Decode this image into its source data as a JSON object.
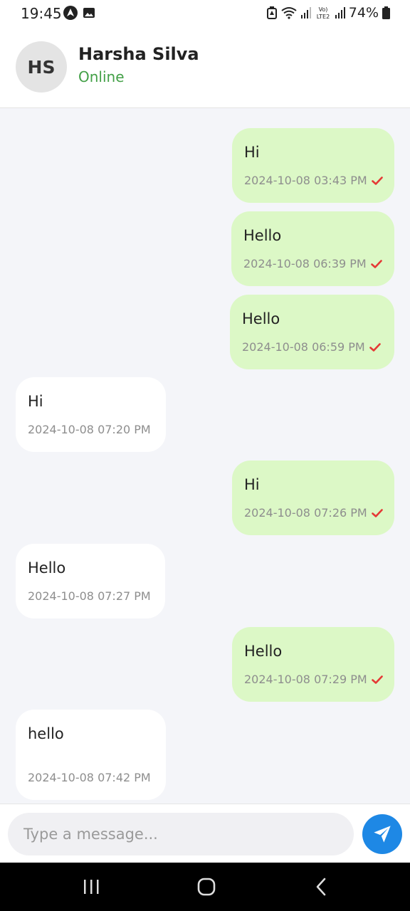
{
  "status_bar": {
    "time": "19:45",
    "battery": "74%",
    "icons": [
      "navigation-app-icon",
      "image-notification-icon",
      "battery-saver-icon",
      "wifi-icon",
      "signal-icon",
      "volte-lte2-icon",
      "signal-icon-2",
      "battery-icon"
    ]
  },
  "contact": {
    "initials": "HS",
    "name": "Harsha Silva",
    "status": "Online",
    "status_color": "#43a047"
  },
  "colors": {
    "sent_bubble": "#dcf8c6",
    "received_bubble": "#ffffff",
    "chat_background": "#f4f5f9",
    "send_button": "#1e88e5",
    "tick": "#e53935"
  },
  "messages": [
    {
      "direction": "sent",
      "text": "Hi",
      "time": "2024-10-08 03:43 PM",
      "read": true
    },
    {
      "direction": "sent",
      "text": "Hello",
      "time": "2024-10-08 06:39 PM",
      "read": true
    },
    {
      "direction": "sent",
      "text": "Hello",
      "time": "2024-10-08 06:59 PM",
      "read": true
    },
    {
      "direction": "received",
      "text": "Hi",
      "time": "2024-10-08 07:20 PM"
    },
    {
      "direction": "sent",
      "text": "Hi",
      "time": "2024-10-08 07:26 PM",
      "read": true
    },
    {
      "direction": "received",
      "text": "Hello",
      "time": "2024-10-08 07:27 PM"
    },
    {
      "direction": "sent",
      "text": "Hello",
      "time": "2024-10-08 07:29 PM",
      "read": true
    },
    {
      "direction": "received",
      "text": "hello",
      "time": "2024-10-08 07:42 PM"
    }
  ],
  "composer": {
    "placeholder": "Type a message...",
    "value": ""
  },
  "nav_bar": {
    "buttons": [
      "recent-apps-icon",
      "home-icon",
      "back-icon"
    ]
  }
}
